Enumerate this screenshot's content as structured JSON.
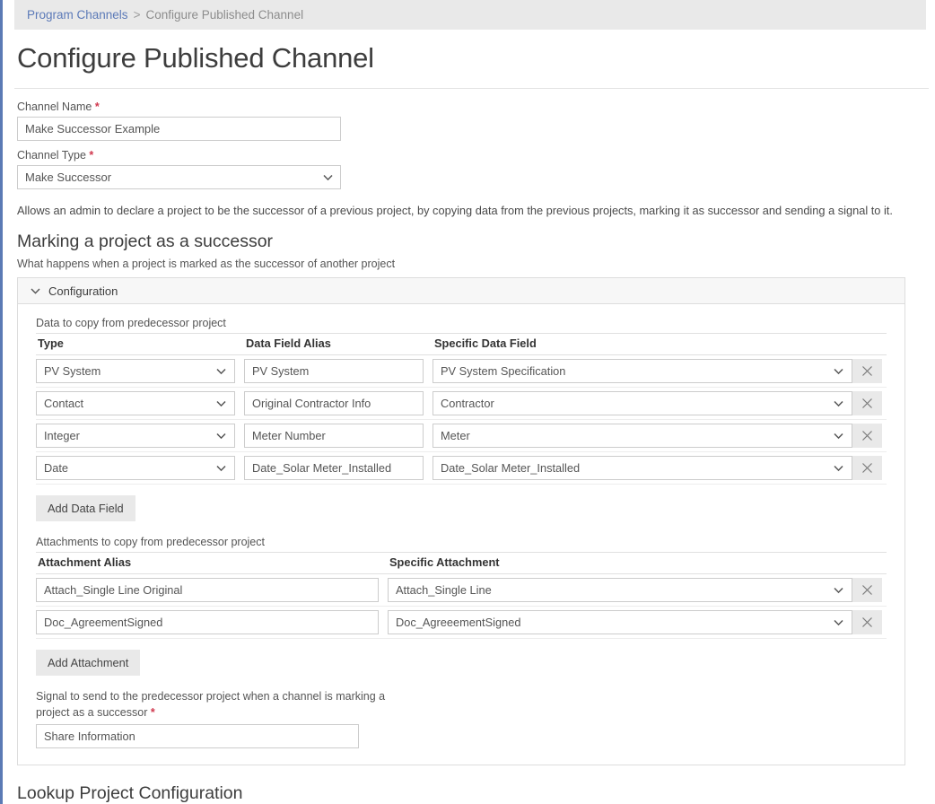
{
  "breadcrumb": {
    "link_label": "Program Channels",
    "separator": ">",
    "current_label": "Configure Published Channel"
  },
  "page": {
    "title": "Configure Published Channel"
  },
  "form": {
    "channel_name": {
      "label": "Channel Name",
      "required_marker": "*",
      "value": "Make Successor Example"
    },
    "channel_type": {
      "label": "Channel Type",
      "required_marker": "*",
      "value": "Make Successor"
    },
    "description": "Allows an admin to declare a project to be the successor of a previous project, by copying data from the previous projects, marking it as successor and sending a signal to it."
  },
  "successor_section": {
    "heading": "Marking a project as a successor",
    "subheading": "What happens when a project is marked as the successor of another project"
  },
  "configuration_panel": {
    "title": "Configuration",
    "expanded": true,
    "data_fields": {
      "caption": "Data to copy from predecessor project",
      "columns": [
        "Type",
        "Data Field Alias",
        "Specific Data Field"
      ],
      "rows": [
        {
          "type": "PV System",
          "alias": "PV System",
          "specific": "PV System Specification"
        },
        {
          "type": "Contact",
          "alias": "Original Contractor Info",
          "specific": "Contractor"
        },
        {
          "type": "Integer",
          "alias": "Meter Number",
          "specific": "Meter"
        },
        {
          "type": "Date",
          "alias": "Date_Solar Meter_Installed",
          "specific": "Date_Solar Meter_Installed"
        }
      ],
      "add_button_label": "Add Data Field",
      "remove_icon": "close-icon"
    },
    "attachments": {
      "caption": "Attachments to copy from predecessor project",
      "columns": [
        "Attachment Alias",
        "Specific Attachment"
      ],
      "rows": [
        {
          "alias": "Attach_Single Line Original",
          "specific": "Attach_Single Line"
        },
        {
          "alias": "Doc_AgreementSigned",
          "specific": "Doc_AgreeementSigned"
        }
      ],
      "add_button_label": "Add Attachment",
      "remove_icon": "close-icon"
    },
    "signal": {
      "label": "Signal to send to the predecessor project when a channel is marking a project as a successor",
      "required_marker": "*",
      "value": "Share Information"
    }
  },
  "lookup_section": {
    "heading": "Lookup Project Configuration"
  },
  "colors": {
    "accent_rail": "#5b7ab5",
    "breadcrumb_link": "#5c7ab8",
    "required_marker": "#d0384e",
    "breadcrumb_bg": "#e9e9e9",
    "button_bg": "#e9e9e9",
    "panel_header_bg": "#f7f7f7"
  },
  "icons": {
    "chevron_down": "chevron-down-icon",
    "close": "close-icon"
  }
}
